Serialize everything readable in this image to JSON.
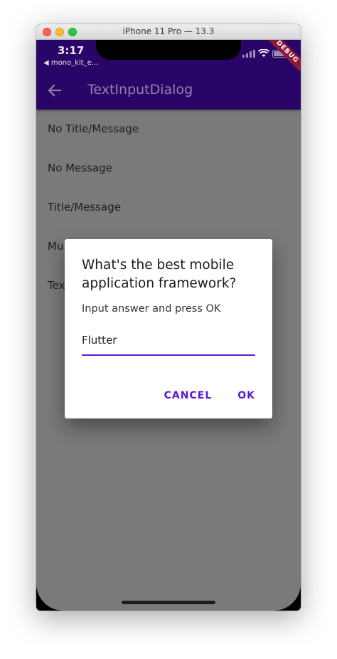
{
  "window": {
    "title": "iPhone 11 Pro — 13.3"
  },
  "statusbar": {
    "time": "3:17",
    "back_app": "◀ mono_kit_e..."
  },
  "debug_banner": "DEBUG",
  "appbar": {
    "title": "TextInputDialog"
  },
  "list": {
    "items": [
      {
        "label": "No Title/Message"
      },
      {
        "label": "No Message"
      },
      {
        "label": "Title/Message"
      },
      {
        "label": "Mu"
      },
      {
        "label": "Tex"
      }
    ]
  },
  "dialog": {
    "title": "What's the best mobile application framework?",
    "message": "Input answer and press OK",
    "input_value": "Flutter",
    "cancel_label": "CANCEL",
    "ok_label": "OK"
  },
  "colors": {
    "primary": "#2a0568",
    "accent": "#5a1bd0",
    "scrim_background": "#7a7a7a"
  }
}
